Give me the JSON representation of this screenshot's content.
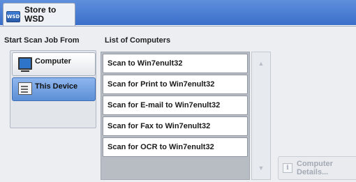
{
  "header": {
    "icon_label": "WSD",
    "title": "Store to WSD"
  },
  "left": {
    "label": "Start Scan Job From",
    "options": [
      {
        "label": "Computer",
        "icon": "monitor-icon",
        "selected": false
      },
      {
        "label": "This Device",
        "icon": "device-icon",
        "selected": true
      }
    ]
  },
  "list": {
    "label": "List of Computers",
    "items": [
      "Scan to Win7enult32",
      "Scan for Print to Win7enult32",
      "Scan for E-mail to Win7enult32",
      "Scan for Fax to Win7enult32",
      "Scan for OCR to Win7enult32"
    ]
  },
  "scroll": {
    "up_icon": "up-arrow-icon",
    "down_icon": "down-arrow-icon",
    "up_glyph": "▲",
    "down_glyph": "▼"
  },
  "details": {
    "label": "Computer Details...",
    "icon": "info-icon",
    "icon_glyph": "i",
    "enabled": false
  },
  "colors": {
    "header_blue": "#3a6fca",
    "selected_blue": "#5c8fd6"
  }
}
